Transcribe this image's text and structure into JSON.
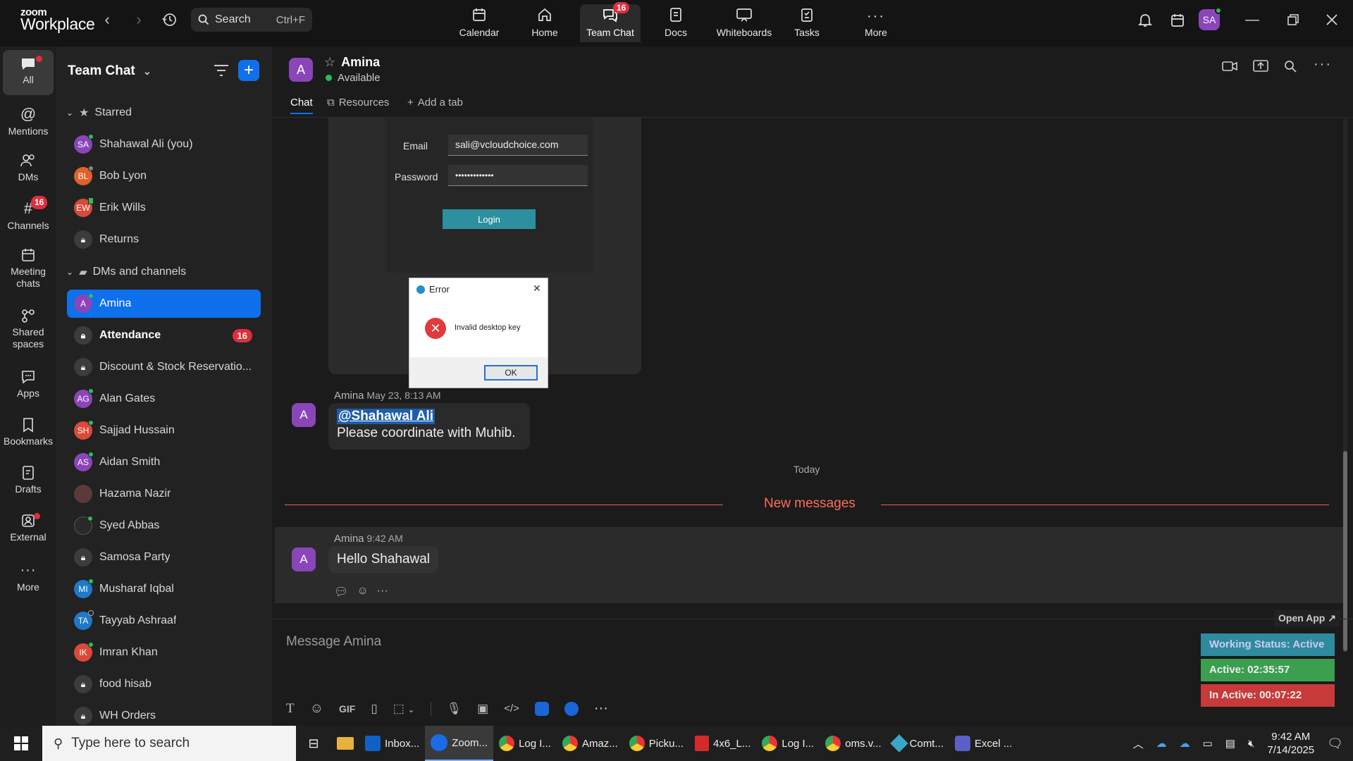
{
  "app": {
    "brand_small": "zoom",
    "brand_big": "Workplace",
    "search_placeholder": "Search",
    "search_shortcut": "Ctrl+F",
    "nav_tabs": [
      {
        "label": "Calendar",
        "icon": "calendar-icon"
      },
      {
        "label": "Home",
        "icon": "home-icon"
      },
      {
        "label": "Team Chat",
        "icon": "chat-icon",
        "badge": "16"
      },
      {
        "label": "Docs",
        "icon": "docs-icon"
      },
      {
        "label": "Whiteboards",
        "icon": "whiteboard-icon"
      },
      {
        "label": "Tasks",
        "icon": "tasks-icon"
      },
      {
        "label": "More",
        "icon": "more-icon"
      }
    ],
    "avatar_initials": "SA"
  },
  "rail": {
    "items": [
      {
        "label": "All"
      },
      {
        "label": "Mentions"
      },
      {
        "label": "DMs"
      },
      {
        "label": "Channels",
        "badge": "16"
      },
      {
        "label": "Meeting chats"
      },
      {
        "label": "Shared spaces"
      },
      {
        "label": "Apps"
      },
      {
        "label": "Bookmarks"
      },
      {
        "label": "Drafts"
      },
      {
        "label": "External"
      },
      {
        "label": "More"
      }
    ]
  },
  "sidebar": {
    "title": "Team Chat",
    "starred_label": "Starred",
    "starred": [
      {
        "name": "Shahawal Ali (you)",
        "initials": "SA",
        "color": "#8a45b8"
      },
      {
        "name": "Bob Lyon",
        "initials": "BL",
        "color": "#e0622a"
      },
      {
        "name": "Erik Wills",
        "initials": "EW",
        "color": "#d94a3a"
      },
      {
        "name": "Returns",
        "initials": "",
        "color": "#3c3c3c"
      }
    ],
    "dm_label": "DMs and channels",
    "dms": [
      {
        "name": "Amina",
        "initials": "A",
        "color": "#8a45b8"
      },
      {
        "name": "Attendance",
        "initials": "",
        "color": "#3c3c3c",
        "count": "16"
      },
      {
        "name": "Discount & Stock Reservatio...",
        "initials": "",
        "color": "#3c3c3c"
      },
      {
        "name": "Alan Gates",
        "initials": "AG",
        "color": "#8a45b8"
      },
      {
        "name": "Sajjad Hussain",
        "initials": "SH",
        "color": "#d94a3a"
      },
      {
        "name": "Aidan Smith",
        "initials": "AS",
        "color": "#8a45b8"
      },
      {
        "name": "Hazama Nazir",
        "initials": "",
        "color": "#5a3a3a"
      },
      {
        "name": "Syed Abbas",
        "initials": "",
        "color": "#2a2a2a"
      },
      {
        "name": "Samosa Party",
        "initials": "",
        "color": "#3c3c3c"
      },
      {
        "name": "Musharaf Iqbal",
        "initials": "MI",
        "color": "#1f78c8"
      },
      {
        "name": "Tayyab Ashraaf",
        "initials": "TA",
        "color": "#1f78c8"
      },
      {
        "name": "Imran Khan",
        "initials": "IK",
        "color": "#d94a3a"
      },
      {
        "name": "food hisab",
        "initials": "",
        "color": "#3c3c3c"
      },
      {
        "name": "WH Orders",
        "initials": "",
        "color": "#3c3c3c"
      }
    ]
  },
  "chat": {
    "contact": "Amina",
    "contact_initial": "A",
    "status": "Available",
    "tabs": {
      "chat": "Chat",
      "resources": "Resources",
      "add": "Add a tab"
    },
    "screenshot": {
      "email_label": "Email",
      "email_value": "sali@vcloudchoice.com",
      "password_label": "Password",
      "password_value": "•••••••••••••",
      "login": "Login",
      "error_title": "Error",
      "error_msg": "Invalid desktop key",
      "ok": "OK"
    },
    "msg1": {
      "author": "Amina",
      "time": "May 23, 8:13 AM",
      "mention": "@Shahawal Ali",
      "text": "Please coordinate with Muhib."
    },
    "today": "Today",
    "new_messages": "New messages",
    "msg2": {
      "author": "Amina",
      "time": "9:42 AM",
      "text": "Hello Shahawal"
    },
    "composer_placeholder": "Message Amina",
    "gif_label": "GIF"
  },
  "overlay": {
    "open_app": "Open App ↗",
    "working_status": "Working Status: Active",
    "active": "Active: 02:35:57",
    "inactive": "In Active: 00:07:22"
  },
  "taskbar": {
    "search_placeholder": "Type here to search",
    "items": [
      "Inbox...",
      "Zoom...",
      "Log I...",
      "Amaz...",
      "Picku...",
      "4x6_L...",
      "Log I...",
      "oms.v...",
      "Comt...",
      "Excel ..."
    ],
    "time": "9:42 AM",
    "date": "7/14/2025"
  },
  "colors": {
    "accent": "#0e71eb",
    "badge": "#e02e3c",
    "presence": "#2bbd5b",
    "new_messages": "#ff6b5b"
  }
}
